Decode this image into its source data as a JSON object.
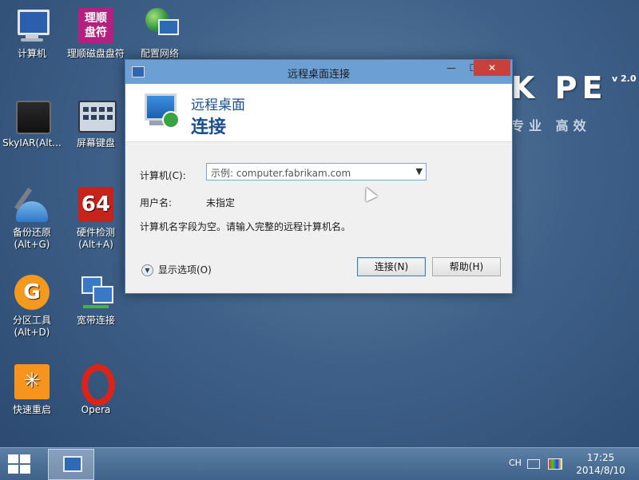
{
  "desktop": {
    "brand": "K PE",
    "brand_version": "v 2.0",
    "brand_sub": "专业  高效",
    "icons": [
      {
        "label": "计算机"
      },
      {
        "label": "理顺磁盘盘符",
        "tile_text": "理顺\n盘符"
      },
      {
        "label": "配置网络"
      },
      {
        "label": "SkyIAR(Alt..."
      },
      {
        "label": "屏幕键盘"
      },
      {
        "label": "备份还原\n(Alt+G)"
      },
      {
        "label": "硬件检测\n(Alt+A)",
        "tile_text": "64"
      },
      {
        "label": "分区工具\n(Alt+D)",
        "tile_text": "G"
      },
      {
        "label": "宽带连接"
      },
      {
        "label": "快速重启",
        "tile_text": "✳"
      },
      {
        "label": "Opera"
      }
    ]
  },
  "dialog": {
    "title": "远程桌面连接",
    "min": "—",
    "max": "☐",
    "close": "✕",
    "header_line1": "远程桌面",
    "header_line2": "连接",
    "computer_label": "计算机(C):",
    "computer_placeholder": "示例: computer.fabrikam.com",
    "combo_arrow": "▼",
    "username_label": "用户名:",
    "username_value": "未指定",
    "message": "计算机名字段为空。请输入完整的远程计算机名。",
    "show_options_icon": "▼",
    "show_options": "显示选项(O)",
    "connect_button": "连接(N)",
    "help_button": "帮助(H)"
  },
  "taskbar": {
    "lang": "CH",
    "time": "17:25",
    "date": "2014/8/10"
  }
}
